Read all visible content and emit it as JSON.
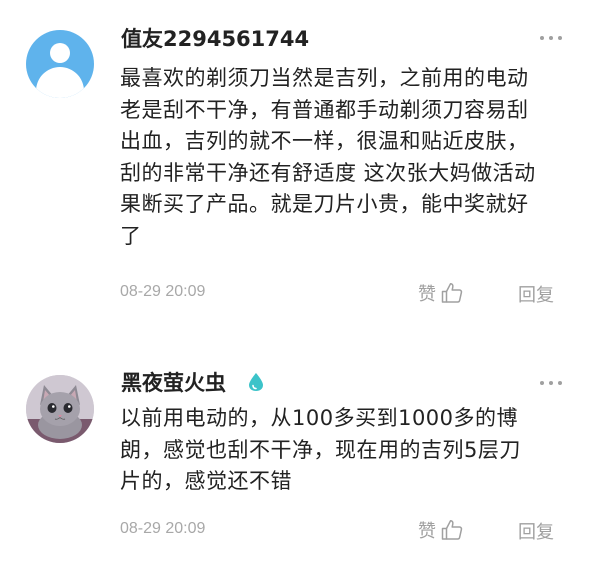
{
  "comments": [
    {
      "username": "值友2294561744",
      "avatar_icon": "default-user-avatar-icon",
      "content": "最喜欢的剃须刀当然是吉列，之前用的电动\n老是刮不干净，有普通都手动剃须刀容易刮\n出血，吉列的就不一样，很温和贴近皮肤，\n刮的非常干净还有舒适度 这次张大妈做活动\n果断买了产品。就是刀片小贵，能中奖就好\n了",
      "time": "08-29 20:09",
      "like_label": "赞",
      "reply_label": "回复"
    },
    {
      "username": "黑夜萤火虫",
      "avatar_icon": "cat-photo-avatar",
      "verified_icon": "water-drop-badge-icon",
      "content": "以前用电动的，从100多买到1000多的博\n朗，感觉也刮不干净，现在用的吉列5层刀\n片的，感觉还不错",
      "time": "08-29 20:09",
      "like_label": "赞",
      "reply_label": "回复"
    }
  ],
  "colors": {
    "avatar_blue": "#5fb3ec",
    "verified_teal": "#3cc3c9",
    "muted_text": "#a0a0a0"
  }
}
